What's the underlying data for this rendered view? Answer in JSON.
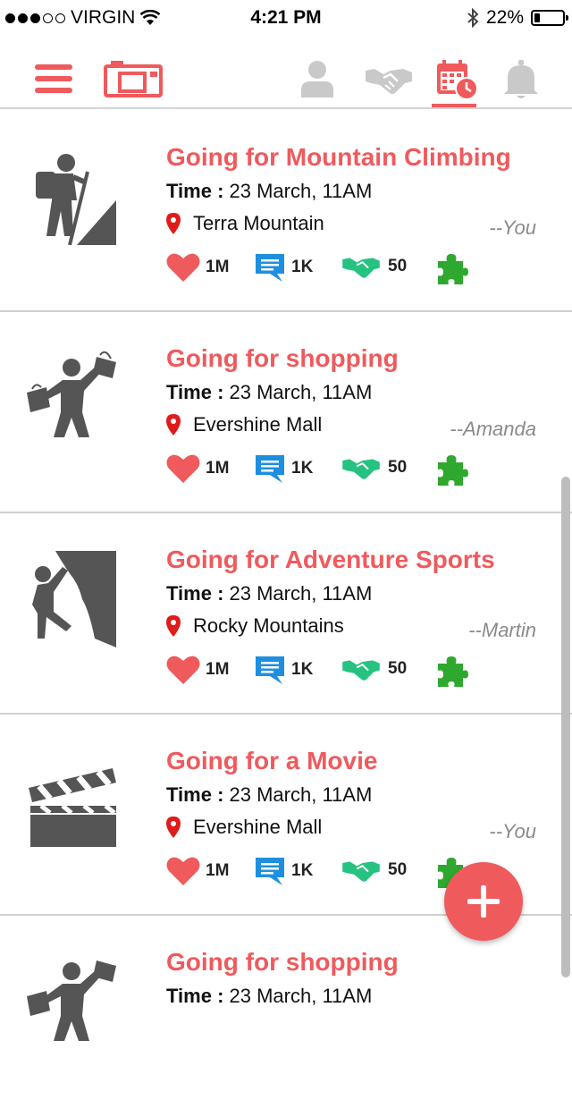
{
  "status_bar": {
    "carrier": "VIRGIN",
    "time": "4:21 PM",
    "battery": "22%"
  },
  "colors": {
    "accent": "#ef5a5d",
    "like": "#ef5a5d",
    "comment": "#1e8fe0",
    "join": "#26c281",
    "puzzle": "#2ea82e",
    "inactive": "#c9c9c9"
  },
  "nav": {
    "icons": [
      "menu-icon",
      "camera-icon",
      "profile-icon",
      "handshake-icon",
      "calendar-icon",
      "bell-icon"
    ],
    "active": "calendar-icon"
  },
  "feed": [
    {
      "title": "Going for Mountain Climbing",
      "time_label": "Time :",
      "time": "23 March, 11AM",
      "location": "Terra Mountain",
      "by": "--You",
      "likes": "1M",
      "comments": "1K",
      "joins": "50",
      "icon": "hiker-icon"
    },
    {
      "title": "Going for shopping",
      "time_label": "Time :",
      "time": "23 March, 11AM",
      "location": "Evershine Mall",
      "by": "--Amanda",
      "likes": "1M",
      "comments": "1K",
      "joins": "50",
      "icon": "shopper-icon"
    },
    {
      "title": "Going for Adventure Sports",
      "time_label": "Time :",
      "time": "23 March, 11AM",
      "location": "Rocky Mountains",
      "by": "--Martin",
      "likes": "1M",
      "comments": "1K",
      "joins": "50",
      "icon": "rock-climber-icon"
    },
    {
      "title": "Going for a Movie",
      "time_label": "Time :",
      "time": "23 March, 11AM",
      "location": "Evershine Mall",
      "by": "--You",
      "likes": "1M",
      "comments": "1K",
      "joins": "50",
      "icon": "clapperboard-icon"
    },
    {
      "title": "Going for shopping",
      "time_label": "Time :",
      "time": "23 March, 11AM",
      "location": "",
      "by": "",
      "likes": "",
      "comments": "",
      "joins": "",
      "icon": "shopper-icon"
    }
  ],
  "fab": {
    "icon": "plus-icon"
  }
}
